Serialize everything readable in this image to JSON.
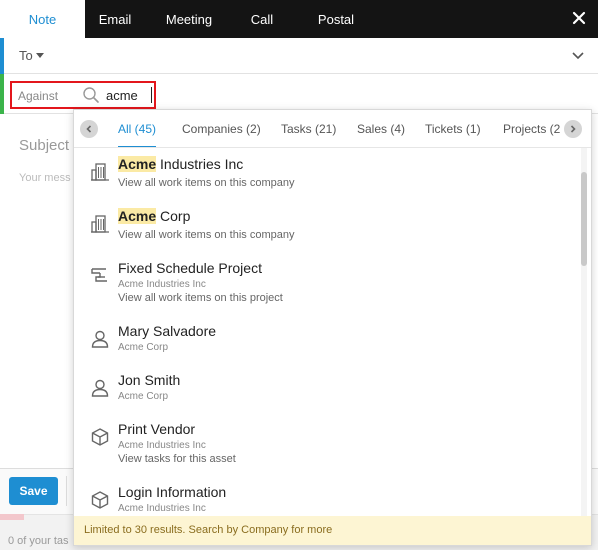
{
  "tabs": {
    "note": "Note",
    "email": "Email",
    "meeting": "Meeting",
    "call": "Call",
    "postal": "Postal"
  },
  "to_row": {
    "label": "To"
  },
  "against": {
    "label": "Against",
    "query": "acme"
  },
  "editor": {
    "subject_placeholder": "Subject",
    "message_placeholder": "Your mess"
  },
  "filters": {
    "all": "All (45)",
    "companies": "Companies (2)",
    "tasks": "Tasks (21)",
    "sales": "Sales (4)",
    "tickets": "Tickets (1)",
    "projects": "Projects (2"
  },
  "results": [
    {
      "icon": "company-icon",
      "match": "Acme",
      "rest": " Industries Inc",
      "sub": "",
      "desc": "View all work items on this company"
    },
    {
      "icon": "company-icon",
      "match": "Acme",
      "rest": " Corp",
      "sub": "",
      "desc": "View all work items on this company"
    },
    {
      "icon": "project-icon",
      "match": "",
      "rest": "Fixed Schedule Project",
      "sub": "Acme Industries Inc",
      "desc": "View all work items on this project"
    },
    {
      "icon": "person-icon",
      "match": "",
      "rest": "Mary Salvadore",
      "sub": "Acme Corp",
      "desc": ""
    },
    {
      "icon": "person-icon",
      "match": "",
      "rest": "Jon Smith",
      "sub": "Acme Corp",
      "desc": ""
    },
    {
      "icon": "asset-icon",
      "match": "",
      "rest": "Print Vendor",
      "sub": "Acme Industries Inc",
      "desc": "View tasks for this asset"
    },
    {
      "icon": "asset-icon",
      "match": "",
      "rest": "Login Information",
      "sub": "Acme Industries Inc",
      "desc": ""
    }
  ],
  "footer": {
    "message": "Limited to 30 results. Search by Company for more"
  },
  "bottom": {
    "save_label": "Save",
    "task_count": "0 of your tas"
  },
  "colors": {
    "accent_blue": "#1e8ed2",
    "accent_green": "#3bb44a",
    "highlight": "#fbeaa5",
    "outline_red": "#e3161c",
    "footer_bg": "#fdf5d3",
    "topbar_bg": "#141414"
  }
}
